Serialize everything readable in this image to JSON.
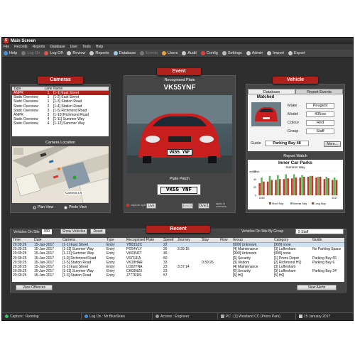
{
  "window": {
    "title": "Main Screen",
    "logo": "S"
  },
  "menu": [
    "File",
    "Records",
    "Reports",
    "Database",
    "User",
    "Tools",
    "Help"
  ],
  "toolbar": [
    {
      "label": "Help",
      "icon": "help-icon",
      "color": "#4a90d9",
      "enabled": true
    },
    {
      "label": "Log On",
      "icon": "log-on-icon",
      "color": "#777777",
      "enabled": false
    },
    {
      "label": "Log Off",
      "icon": "log-off-icon",
      "color": "#d9534f",
      "enabled": true
    },
    {
      "label": "Review",
      "icon": "review-icon",
      "color": "#cccccc",
      "enabled": true
    },
    {
      "label": "Reports",
      "icon": "reports-icon",
      "color": "#cccccc",
      "enabled": true
    },
    {
      "label": "Database",
      "icon": "database-icon",
      "color": "#9ecae1",
      "enabled": true
    },
    {
      "label": "Events",
      "icon": "events-icon",
      "color": "#777777",
      "enabled": false
    },
    {
      "label": "Users",
      "icon": "users-icon",
      "color": "#e8a33d",
      "enabled": true
    },
    {
      "label": "Audit",
      "icon": "audit-icon",
      "color": "#cccccc",
      "enabled": true
    },
    {
      "label": "Config",
      "icon": "config-icon",
      "color": "#e04040",
      "enabled": true
    },
    {
      "label": "Settings",
      "icon": "settings-icon",
      "color": "#bbbbbb",
      "enabled": true
    },
    {
      "label": "Admin",
      "icon": "admin-icon",
      "color": "#cccccc",
      "enabled": true
    },
    {
      "label": "Import",
      "icon": "import-icon",
      "color": "#cccccc",
      "enabled": true
    },
    {
      "label": "Export",
      "icon": "export-icon",
      "color": "#cccccc",
      "enabled": true
    }
  ],
  "cameras": {
    "title": "Cameras",
    "columns": [
      "Type",
      "Lane",
      "Name"
    ],
    "rows": [
      {
        "type": "ANPR",
        "lane": "1",
        "name": "[1-1] East Street",
        "selected": true
      },
      {
        "type": "Static Overview",
        "lane": "1",
        "name": "[1-2] East Street",
        "selected": false
      },
      {
        "type": "Static Overview",
        "lane": "1",
        "name": "[1-3] Station Road",
        "selected": false
      },
      {
        "type": "Static Overview",
        "lane": "2",
        "name": "[1-4] Station Road",
        "selected": false
      },
      {
        "type": "Static Overview",
        "lane": "3",
        "name": "[1-5] Richmond Road",
        "selected": false
      },
      {
        "type": "ANPR",
        "lane": "3",
        "name": "[1-10] Richmond Road",
        "selected": false
      },
      {
        "type": "Static Overview",
        "lane": "4",
        "name": "[1-11] Summer Way",
        "selected": false
      },
      {
        "type": "Static Overview",
        "lane": "4",
        "name": "[1-12] Summer Way",
        "selected": false
      }
    ],
    "location_label": "Camera Location",
    "map_label": "Camera 4.6",
    "plan_view": "Plan View",
    "photo_view": "Photo View"
  },
  "event": {
    "title": "Event",
    "recognised_label": "Recognised Plate",
    "plate": "VK55YNF",
    "photo_plate": "VK55 YNF",
    "patch_label": "Plate Patch",
    "patch_plate": "VK55 YNF",
    "capture_label": "capture speed",
    "live": "Live",
    "event_btn": "Event",
    "over": "Over1",
    "apply": "apply to overview"
  },
  "vehicle": {
    "title": "Vehicle",
    "tabs": [
      "Database",
      "Report Events"
    ],
    "status": "Matched",
    "make_label": "Make",
    "make": "Peugeot",
    "model_label": "Model",
    "model": "405sw",
    "colour_label": "Colour",
    "colour": "Red",
    "group_label": "Group",
    "group": "Staff",
    "guide_label": "Guide",
    "guide": "Parking Bay 48",
    "more": "More...",
    "report_watch": "Report Watch"
  },
  "chart_data": {
    "type": "bar",
    "title": "Inner Car Parks",
    "subtitle": "Summer Way",
    "ylabel": "vehicles",
    "categories": [
      "2016",
      "",
      "",
      "",
      "",
      "",
      "",
      "",
      "",
      "2017"
    ],
    "series": [
      {
        "name": "Short Stay",
        "color": "#c0392b",
        "values": [
          30,
          34,
          38,
          40,
          42,
          44,
          46,
          44,
          40,
          38
        ]
      },
      {
        "name": "Normal Stay",
        "color": "#5cb85c",
        "values": [
          44,
          48,
          50,
          52,
          52,
          50,
          48,
          46,
          46,
          44
        ]
      },
      {
        "name": "Long Stay",
        "color": "#c0392b",
        "values": [
          34,
          38,
          40,
          42,
          44,
          46,
          48,
          46,
          42,
          38
        ]
      }
    ],
    "yticks": [
      "60",
      "40",
      "20",
      "0"
    ],
    "ylim": [
      0,
      60
    ],
    "legend": "bottom"
  },
  "recent": {
    "title": "Recent",
    "vehicles_on_site_label": "Vehicles On Site",
    "vehicles_on_site": "300",
    "show_vehicles": "Show Vehicles",
    "reset": "Reset",
    "by_group_label": "Vehicles On Site By Group",
    "by_group_value": "5 Staff",
    "columns": [
      "Time",
      "Date",
      "Camera",
      "Type",
      "Recognised Plate",
      "Speed",
      "Journey",
      "Stay",
      "Flow",
      "Group",
      "Category",
      "Guide"
    ],
    "rows": [
      [
        "20:39:26",
        "15-Jan-2017",
        "[1-1] East Street",
        "Entry",
        "YB03SZC",
        "22",
        "",
        "",
        "",
        "[999] Unknown",
        "[999] none",
        ""
      ],
      [
        "20:39:25",
        "15-Jan-2017",
        "[1-11] Summer Way",
        "Entry",
        "PO54YLY",
        "26",
        "2:39:16",
        "",
        "",
        "[4] Maintenance",
        "[3] Luffenham",
        "No Parking Space"
      ],
      [
        "20:39:25",
        "15-Jan-2017",
        "[1-13] Summer Way",
        "Entry",
        "VK03NFT",
        "45",
        "",
        "",
        "",
        "[999] Unknown",
        "[999] none",
        ""
      ],
      [
        "20:39:25",
        "15-Jan-2017",
        "[1-9] Richmond Road",
        "Entry",
        "V673JFA",
        "50",
        "",
        "",
        "",
        "[6] Security",
        "[1] Priors Depot",
        "Parking Bay 65"
      ],
      [
        "20:39:25",
        "15-Jan-2017",
        "[1-5] Station Road",
        "Entry",
        "VK18HAR",
        "33",
        "",
        "0:39:26",
        "",
        "[3] Visitors",
        "[2] Richmond HQ",
        "Parking Bay 6"
      ],
      [
        "20:39:25",
        "15-Jan-2017",
        "[1-1] East Street",
        "Entry",
        "LO02YNA",
        "23",
        "3:37:14",
        "",
        "",
        "[4] Maintenance",
        "[3] Luffenham",
        ""
      ],
      [
        "20:39:25",
        "15-Jan-2017",
        "[1-11] Summer Way",
        "Entry",
        "CK03NZX",
        "23",
        "",
        "",
        "",
        "[6] Security",
        "[3] Luffenham",
        "Parking Bay 34"
      ],
      [
        "20:39:25",
        "15-Jan-2017",
        "[1-3] Station Road",
        "Entry",
        "J777RRS",
        "57",
        "",
        "",
        "",
        "[5] HQ",
        "[5] HQ",
        ""
      ]
    ],
    "view_offences": "View Offences",
    "view_alerts": "View Alerts"
  },
  "status": {
    "capture": "Capture : Running",
    "logon": "Log On : Mr BlueSkies",
    "access": "Access : Engineer",
    "pc": "PC : [1] Westland CC (Priors Park)",
    "date": "15 January 2017"
  }
}
